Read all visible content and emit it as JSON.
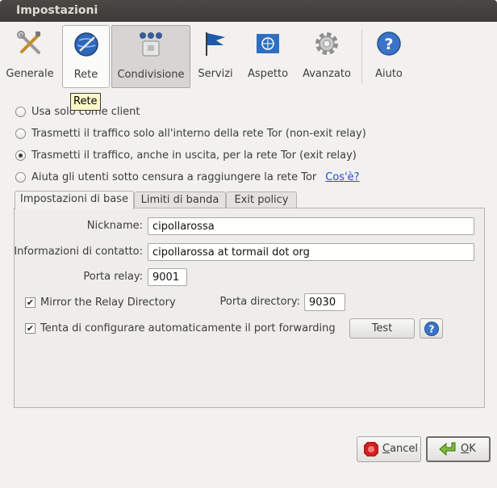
{
  "window": {
    "title": "Impostazioni"
  },
  "toolbar": {
    "items": [
      {
        "label": "Generale",
        "icon": "tools-icon"
      },
      {
        "label": "Rete",
        "icon": "globe-icon"
      },
      {
        "label": "Condivisione",
        "icon": "network-share-icon"
      },
      {
        "label": "Servizi",
        "icon": "flag-icon"
      },
      {
        "label": "Aspetto",
        "icon": "un-emblem-icon"
      },
      {
        "label": "Avanzato",
        "icon": "gear-icon"
      },
      {
        "label": "Aiuto",
        "icon": "help-icon"
      }
    ],
    "tooltip": "Rete"
  },
  "modes": [
    {
      "label": "Usa solo come client",
      "checked": false
    },
    {
      "label": "Trasmetti il traffico solo all'interno della rete Tor (non-exit relay)",
      "checked": false
    },
    {
      "label": "Trasmetti il traffico, anche in uscita, per la rete Tor (exit relay)",
      "checked": true
    },
    {
      "label": "Aiuta gli utenti sotto censura a raggiungere la rete Tor",
      "checked": false
    }
  ],
  "whats_this": "Cos'è?",
  "tabs": [
    "Impostazioni di base",
    "Limiti di banda",
    "Exit policy"
  ],
  "form": {
    "nickname_label": "Nickname:",
    "nickname_value": "cipollarossa",
    "contact_label": "Informazioni di contatto:",
    "contact_value": "cipollarossa at tormail dot org",
    "relay_port_label": "Porta relay:",
    "relay_port_value": "9001",
    "mirror_label": "Mirror the Relay Directory",
    "mirror_checked": true,
    "dir_port_label": "Porta directory:",
    "dir_port_value": "9030",
    "upnp_label": "Tenta di configurare automaticamente il port forwarding",
    "upnp_checked": true,
    "test_label": "Test"
  },
  "buttons": {
    "cancel_prefix": "",
    "cancel_mnemonic": "C",
    "cancel_rest": "ancel",
    "ok_mnemonic": "O",
    "ok_rest": "K"
  }
}
